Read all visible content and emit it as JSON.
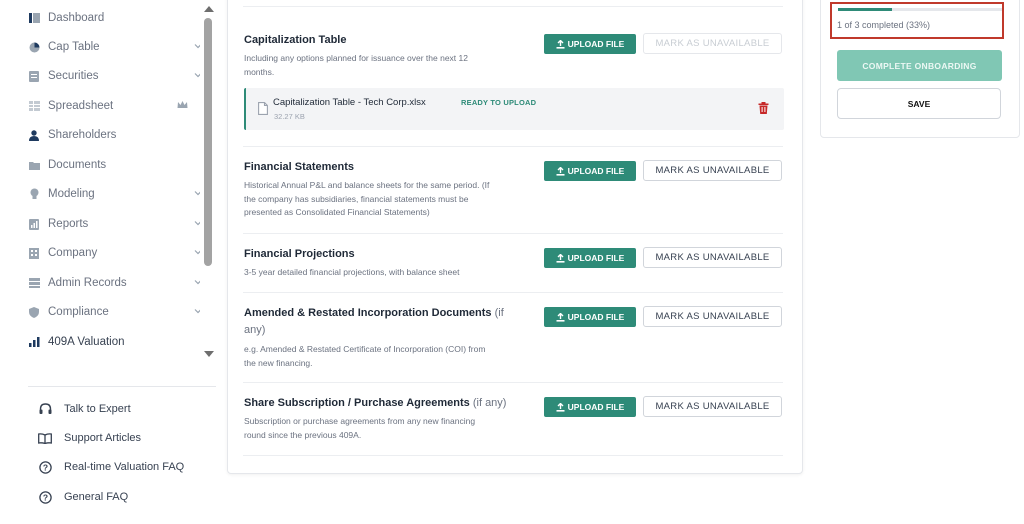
{
  "sidebar": {
    "items": [
      {
        "label": "Dashboard",
        "icon": "dashboard-icon"
      },
      {
        "label": "Cap Table",
        "icon": "pie-chart-icon"
      },
      {
        "label": "Securities",
        "icon": "securities-icon"
      },
      {
        "label": "Spreadsheet",
        "icon": "spreadsheet-icon"
      },
      {
        "label": "Shareholders",
        "icon": "user-icon"
      },
      {
        "label": "Documents",
        "icon": "folder-icon"
      },
      {
        "label": "Modeling",
        "icon": "lightbulb-icon"
      },
      {
        "label": "Reports",
        "icon": "report-icon"
      },
      {
        "label": "Company",
        "icon": "building-icon"
      },
      {
        "label": "Admin Records",
        "icon": "admin-records-icon"
      },
      {
        "label": "Compliance",
        "icon": "shield-icon"
      },
      {
        "label": "409A Valuation",
        "icon": "valuation-chart-icon"
      }
    ],
    "help_items": [
      {
        "label": "Talk to Expert",
        "icon": "headset-icon"
      },
      {
        "label": "Support Articles",
        "icon": "book-icon"
      },
      {
        "label": "Real-time Valuation FAQ",
        "icon": "question-circle-icon"
      },
      {
        "label": "General FAQ",
        "icon": "question-circle-icon"
      }
    ]
  },
  "buttons": {
    "upload_file": "UPLOAD FILE",
    "mark_unavailable": "MARK AS UNAVAILABLE"
  },
  "sections": {
    "cap_table": {
      "title": "Capitalization Table",
      "desc_1": "Including any options planned for issuance over the next 12",
      "desc_2": "months."
    },
    "financial_statements": {
      "title": "Financial Statements",
      "desc_1": "Historical Annual P&L and balance sheets for the same period. (If",
      "desc_2": "the company has subsidiaries, financial statements must be",
      "desc_3": "presented as Consolidated Financial Statements)"
    },
    "financial_projections": {
      "title": "Financial Projections",
      "desc_1": "3-5 year detailed financial projections, with balance sheet"
    },
    "incorporation_docs": {
      "title": "Amended & Restated Incorporation Documents",
      "title_suffix": "(if",
      "title_line2": "any)",
      "desc_1": "e.g. Amended & Restated Certificate of Incorporation (COI) from",
      "desc_2": "the new financing."
    },
    "share_subscription": {
      "title": "Share Subscription / Purchase Agreements",
      "title_suffix": "(if any)",
      "desc_1": "Subscription or purchase agreements from any new financing",
      "desc_2": "round since the previous 409A."
    }
  },
  "uploaded_file": {
    "name": "Capitalization Table - Tech Corp.xlsx",
    "size": "32.27 KB",
    "status": "READY TO UPLOAD"
  },
  "progress": {
    "text": "1 of 3 completed (33%)",
    "fraction": 0.33
  },
  "actions": {
    "complete": "COMPLETE ONBOARDING",
    "save": "SAVE"
  },
  "colors": {
    "brand_green": "#2e8b78",
    "brand_green_light": "#80c7b4",
    "highlight_red": "#c0392b",
    "trash_red": "#c62828"
  }
}
